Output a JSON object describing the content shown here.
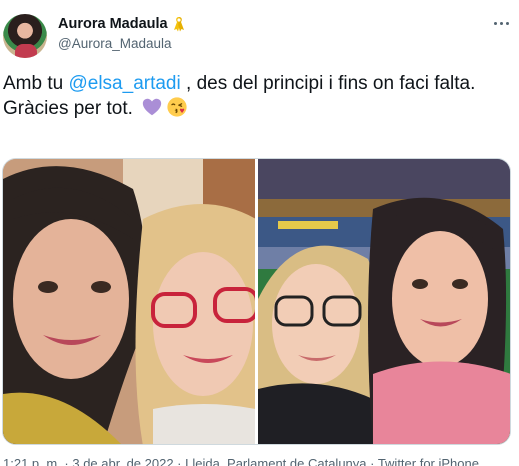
{
  "user": {
    "display_name": "Aurora Madaula",
    "handle": "@Aurora_Madaula",
    "badge_icon": "yellow-ribbon-icon"
  },
  "tweet": {
    "text_before": "Amb tu ",
    "mention": "@elsa_artadi",
    "text_after": " , des del principi i fins on faci falta.",
    "line2": "Gràcies per tot.",
    "emojis": [
      "purple-heart-icon",
      "kissing-face-icon"
    ]
  },
  "media": {
    "photo_count": 2
  },
  "footer": {
    "meta": "1:21 p. m. · 3 de abr. de 2022 · Lleida, Parlament de Catalunya · Twitter for iPhone"
  },
  "colors": {
    "accent": "#1d9bf0",
    "secondary_text": "#536471",
    "primary_text": "#0f1419"
  }
}
